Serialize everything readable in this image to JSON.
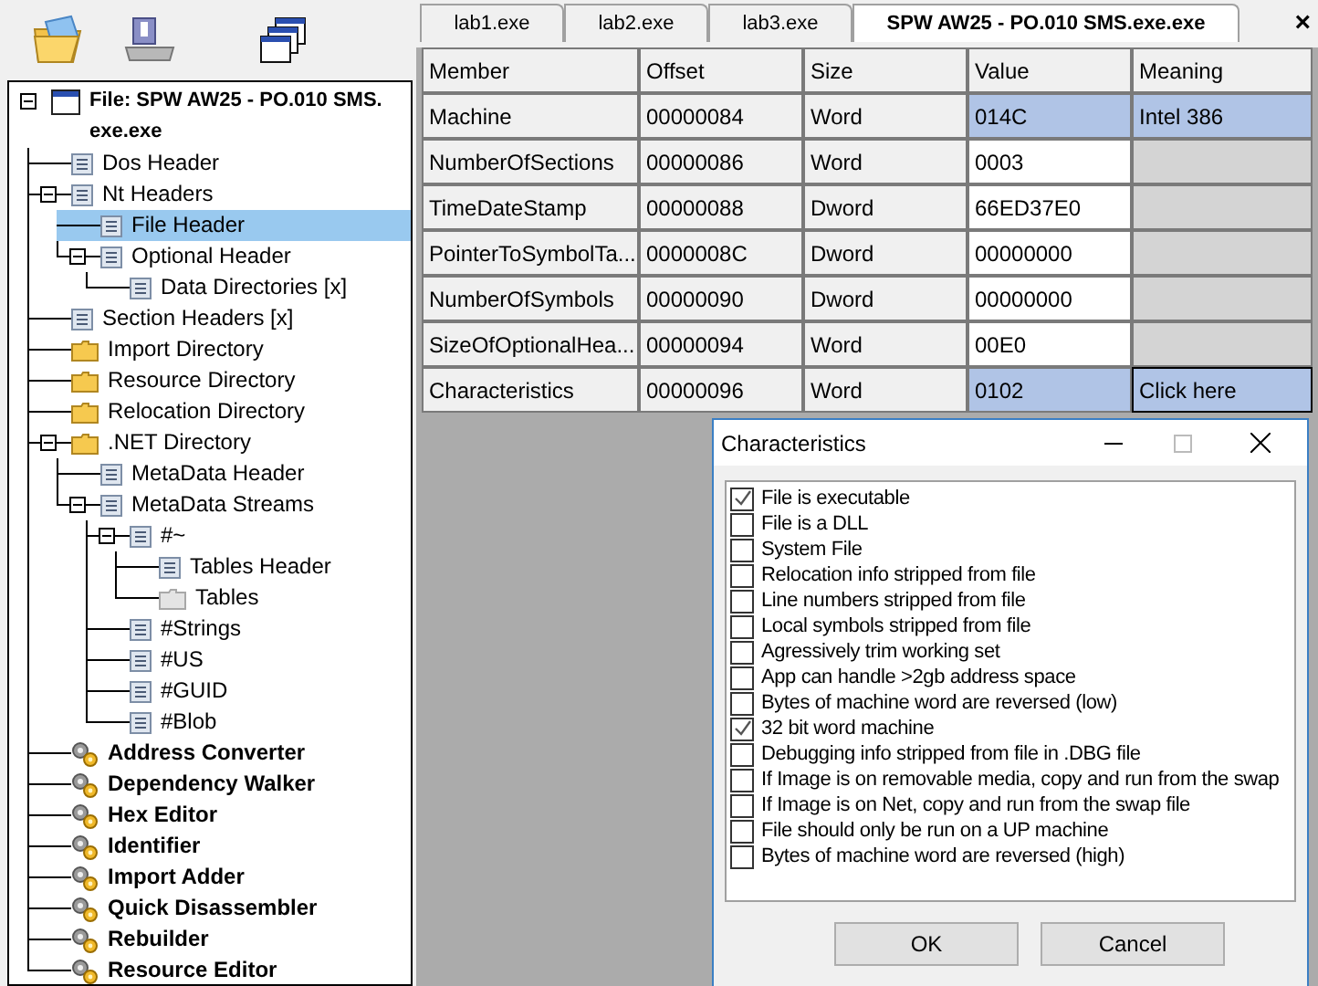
{
  "tree": {
    "root": {
      "label": "File: SPW AW25 - PO.010 SMS.exe.exe",
      "kind": "window",
      "expanded": true,
      "selected": false,
      "children": [
        {
          "label": "Dos Header",
          "kind": "doc",
          "selected": false
        },
        {
          "label": "Nt Headers",
          "kind": "doc",
          "selected": false,
          "expanded": true,
          "children": [
            {
              "label": "File Header",
              "kind": "doc",
              "selected": true
            },
            {
              "label": "Optional Header",
              "kind": "doc",
              "selected": false,
              "expanded": true,
              "children": [
                {
                  "label": "Data Directories [x]",
                  "kind": "doc",
                  "selected": false
                }
              ]
            }
          ]
        },
        {
          "label": "Section Headers [x]",
          "kind": "doc",
          "selected": false
        },
        {
          "label": "Import Directory",
          "kind": "folder",
          "selected": false
        },
        {
          "label": "Resource Directory",
          "kind": "folder",
          "selected": false
        },
        {
          "label": "Relocation Directory",
          "kind": "folder",
          "selected": false
        },
        {
          "label": ".NET Directory",
          "kind": "folder",
          "selected": false,
          "expanded": true,
          "children": [
            {
              "label": "MetaData Header",
              "kind": "doc",
              "selected": false
            },
            {
              "label": "MetaData Streams",
              "kind": "doc",
              "selected": false,
              "expanded": true,
              "children": [
                {
                  "label": "#~",
                  "kind": "doc",
                  "selected": false,
                  "expanded": true,
                  "children": [
                    {
                      "label": "Tables Header",
                      "kind": "doc",
                      "selected": false
                    },
                    {
                      "label": "Tables",
                      "kind": "folder-grey",
                      "selected": false
                    }
                  ]
                },
                {
                  "label": "#Strings",
                  "kind": "doc",
                  "selected": false
                },
                {
                  "label": "#US",
                  "kind": "doc",
                  "selected": false
                },
                {
                  "label": "#GUID",
                  "kind": "doc",
                  "selected": false
                },
                {
                  "label": "#Blob",
                  "kind": "doc",
                  "selected": false
                }
              ]
            }
          ]
        },
        {
          "label": "Address Converter",
          "kind": "gear",
          "selected": false
        },
        {
          "label": "Dependency Walker",
          "kind": "gear",
          "selected": false
        },
        {
          "label": "Hex Editor",
          "kind": "gear",
          "selected": false
        },
        {
          "label": "Identifier",
          "kind": "gear",
          "selected": false
        },
        {
          "label": "Import Adder",
          "kind": "gear",
          "selected": false
        },
        {
          "label": "Quick Disassembler",
          "kind": "gear",
          "selected": false
        },
        {
          "label": "Rebuilder",
          "kind": "gear",
          "selected": false
        },
        {
          "label": "Resource Editor",
          "kind": "gear",
          "selected": false
        }
      ]
    }
  },
  "tabs": [
    {
      "label": "lab1.exe",
      "selected": false
    },
    {
      "label": "lab2.exe",
      "selected": false
    },
    {
      "label": "lab3.exe",
      "selected": false
    },
    {
      "label": "SPW AW25 - PO.010 SMS.exe.exe",
      "selected": true
    }
  ],
  "close_tab": "×",
  "table": {
    "columns": [
      "Member",
      "Offset",
      "Size",
      "Value",
      "Meaning"
    ],
    "rows": [
      {
        "cells": [
          "Machine",
          "00000084",
          "Word",
          "014C",
          "Intel 386"
        ],
        "selected": true,
        "focused": false
      },
      {
        "cells": [
          "NumberOfSections",
          "00000086",
          "Word",
          "0003"
        ],
        "selected": false,
        "focused": false
      },
      {
        "cells": [
          "TimeDateStamp",
          "00000088",
          "Dword",
          "66ED37E0"
        ],
        "selected": false,
        "focused": false
      },
      {
        "cells": [
          "PointerToSymbolTa...",
          "0000008C",
          "Dword",
          "00000000"
        ],
        "selected": false,
        "focused": false
      },
      {
        "cells": [
          "NumberOfSymbols",
          "00000090",
          "Dword",
          "00000000"
        ],
        "selected": false,
        "focused": false
      },
      {
        "cells": [
          "SizeOfOptionalHea...",
          "00000094",
          "Word",
          "00E0"
        ],
        "selected": false,
        "focused": false
      },
      {
        "cells": [
          "Characteristics",
          "00000096",
          "Word",
          "0102",
          "Click here"
        ],
        "selected": true,
        "focused": true
      }
    ]
  },
  "dialog": {
    "title": "Characteristics",
    "flags": [
      {
        "label": "File is executable",
        "checked": true
      },
      {
        "label": "File is a DLL",
        "checked": false
      },
      {
        "label": "System File",
        "checked": false
      },
      {
        "label": "Relocation info stripped from file",
        "checked": false
      },
      {
        "label": "Line numbers stripped from file",
        "checked": false
      },
      {
        "label": "Local symbols stripped from file",
        "checked": false
      },
      {
        "label": "Agressively trim working set",
        "checked": false
      },
      {
        "label": "App can handle >2gb address space",
        "checked": false
      },
      {
        "label": "Bytes of machine word are reversed (low)",
        "checked": false
      },
      {
        "label": "32 bit word machine",
        "checked": true
      },
      {
        "label": "Debugging info stripped from file in .DBG file",
        "checked": false
      },
      {
        "label": "If Image is on removable media, copy and run from the swap",
        "checked": false
      },
      {
        "label": "If Image is on Net, copy and run from the swap file",
        "checked": false
      },
      {
        "label": "File should only be run on a UP machine",
        "checked": false
      },
      {
        "label": "Bytes of machine word are reversed (high)",
        "checked": false
      }
    ],
    "buttons": [
      "OK",
      "Cancel"
    ]
  }
}
